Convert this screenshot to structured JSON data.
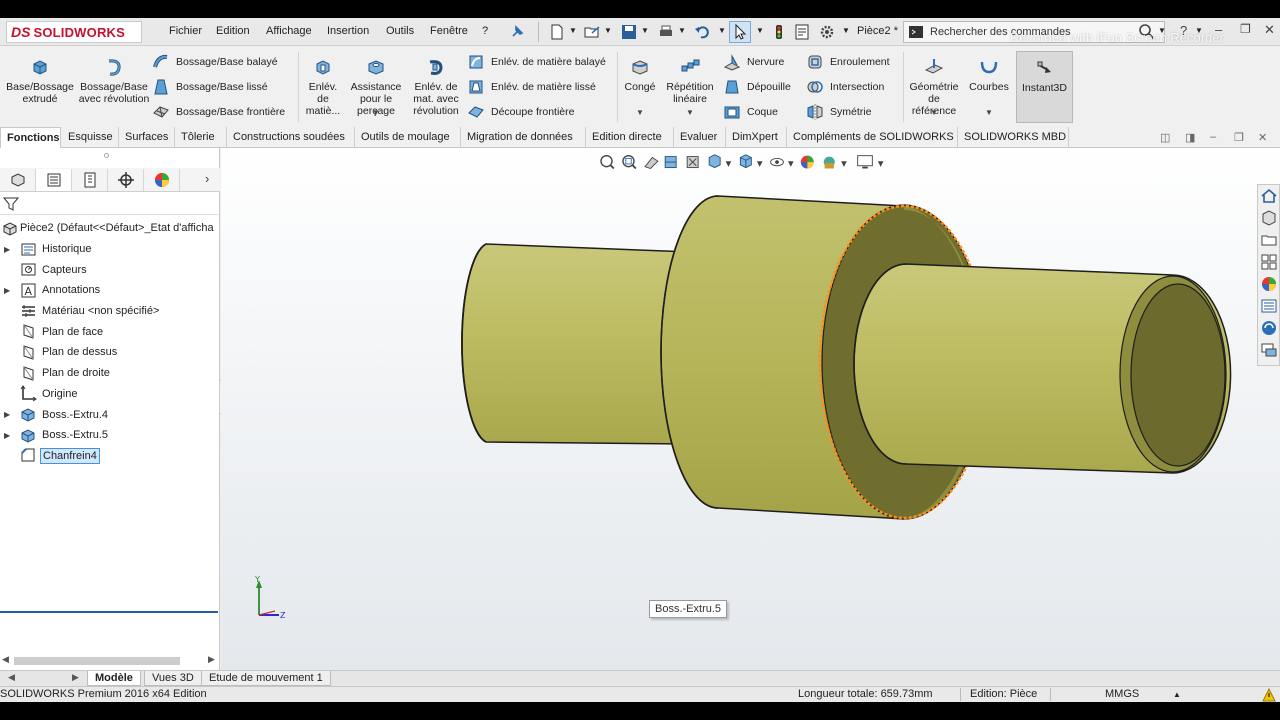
{
  "app": {
    "logo_ds": "DS",
    "logo_name": "SOLIDWORKS",
    "document": "Pièce2 *",
    "search_placeholder": "Rechercher des commandes",
    "watermark": "Recorded with iFun Screen Recorder"
  },
  "menu": [
    "Fichier",
    "Edition",
    "Affichage",
    "Insertion",
    "Outils",
    "Fenêtre",
    "?"
  ],
  "ribbon": {
    "extrude": "Base/Bossage extrudé",
    "revolve": "Bossage/Base avec révolution",
    "swept": "Bossage/Base balayé",
    "lofted": "Bossage/Base lissé",
    "boundary": "Bossage/Base frontière",
    "cut_extrude": "Enlév. de matiè...",
    "hole_wizard": "Assistance pour le perçage",
    "cut_revolve": "Enlév. de mat. avec révolution",
    "cut_swept": "Enlév. de matière balayé",
    "cut_lofted": "Enlév. de matière lissé",
    "cut_boundary": "Découpe frontière",
    "fillet": "Congé",
    "linear_pattern": "Répétition linéaire",
    "rib": "Nervure",
    "draft": "Dépouille",
    "shell": "Coque",
    "wrap": "Enroulement",
    "intersect": "Intersection",
    "mirror": "Symétrie",
    "ref_geometry": "Géométrie de référence",
    "curves": "Courbes",
    "instant3d": "Instant3D"
  },
  "tabs": [
    "Fonctions",
    "Esquisse",
    "Surfaces",
    "Tôlerie",
    "Constructions soudées",
    "Outils de moulage",
    "Migration de données",
    "Edition directe",
    "Evaluer",
    "DimXpert",
    "Compléments de SOLIDWORKS",
    "SOLIDWORKS MBD"
  ],
  "tree": {
    "root": "Pièce2  (Défaut<<Défaut>_Etat d'afficha",
    "items": [
      {
        "label": "Historique",
        "expandable": true
      },
      {
        "label": "Capteurs",
        "expandable": false
      },
      {
        "label": "Annotations",
        "expandable": true
      },
      {
        "label": "Matériau <non spécifié>",
        "expandable": false
      },
      {
        "label": "Plan de face",
        "expandable": false
      },
      {
        "label": "Plan de dessus",
        "expandable": false
      },
      {
        "label": "Plan de droite",
        "expandable": false
      },
      {
        "label": "Origine",
        "expandable": false
      },
      {
        "label": "Boss.-Extru.4",
        "expandable": true
      },
      {
        "label": "Boss.-Extru.5",
        "expandable": true
      },
      {
        "label": "Chanfrein4",
        "expandable": false
      }
    ]
  },
  "viewport": {
    "tooltip": "Boss.-Extru.5",
    "triad_y": "Y",
    "triad_z": "Z"
  },
  "bottom_tabs": [
    "Modèle",
    "Vues 3D",
    "Etude de mouvement 1"
  ],
  "status": {
    "product": "SOLIDWORKS Premium 2016 x64 Edition",
    "length": "Longueur totale: 659.73mm",
    "mode": "Edition: Pièce",
    "units": "MMGS"
  },
  "colors": {
    "part_body": "#bcbb5e",
    "part_shadow": "#6e6d2e",
    "selection": "#ff8c1a",
    "brand": "#c8102e"
  }
}
